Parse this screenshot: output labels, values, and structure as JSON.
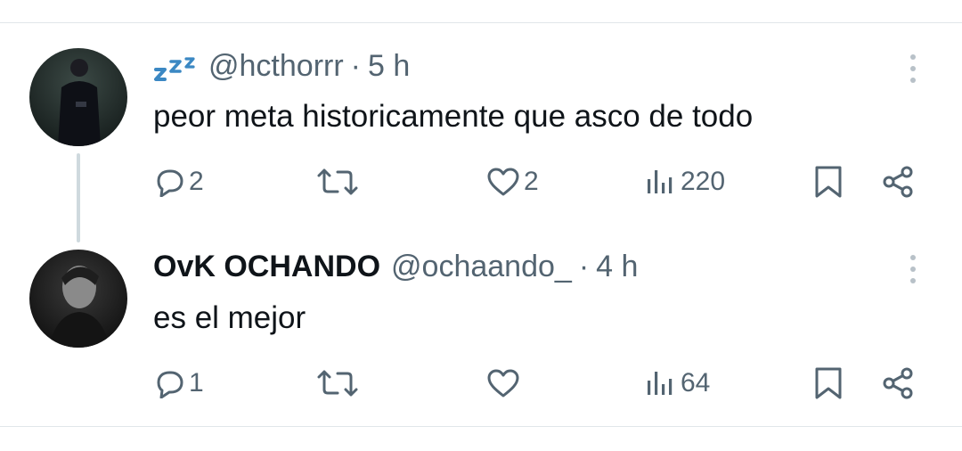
{
  "tweets": [
    {
      "display_name": "",
      "emoji_icon": "sleeping-zzz-icon",
      "handle": "@hcthorrr",
      "separator": "·",
      "time": "5 h",
      "text": "peor meta historicamente que asco de todo",
      "replies": "2",
      "retweets": "",
      "likes": "2",
      "views": "220"
    },
    {
      "display_name": "OvK OCHANDO",
      "handle": "@ochaando_",
      "separator": "·",
      "time": "4 h",
      "text": "es el mejor",
      "replies": "1",
      "retweets": "",
      "likes": "",
      "views": "64"
    }
  ],
  "colors": {
    "text": "#0f1419",
    "secondary": "#536471",
    "divider": "#e1e6ea",
    "thread_line": "#cfd9de",
    "zzz_blue": "#3b88c3"
  }
}
